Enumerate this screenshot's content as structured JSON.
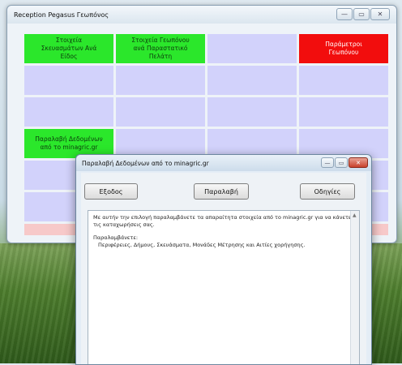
{
  "main_window": {
    "title": "Reception Pegasus Γεωπόνος",
    "controls": {
      "minimize": "—",
      "maximize": "▭",
      "close": "✕"
    },
    "tiles": [
      {
        "line1": "Στοιχεία",
        "line2": "Σκευασμάτων Ανά",
        "line3": "Είδος",
        "color": "green"
      },
      {
        "line1": "Στοιχεία Γεωπόνου",
        "line2": "ανά Παραστατικό",
        "line3": "Πελάτη",
        "color": "green"
      },
      {
        "line1": "",
        "line2": "",
        "line3": "",
        "color": "lavender"
      },
      {
        "line1": "Παράμετροι",
        "line2": "Γεωπόνου",
        "line3": "",
        "color": "red"
      },
      {
        "line1": "Παραλαβή Δεδομένων",
        "line2": "από το minagric.gr",
        "line3": "",
        "color": "green"
      }
    ]
  },
  "dialog": {
    "title": "Παραλαβή Δεδομένων από το minagric.gr",
    "controls": {
      "minimize": "—",
      "maximize": "▭",
      "close": "✕"
    },
    "buttons": {
      "exit": "Εξοδος",
      "receive": "Παραλαβή",
      "guide": "Οδηγίες"
    },
    "text": {
      "line1": "Με αυτήν την επιλογή παραλαμβάνετε τα απαραίτητα στοιχεία από το minagric.gr για να κάνετε",
      "line2": "τις καταχωρήσεις σας.",
      "heading": "Παραλαμβάνετε:",
      "items": "Περιφέρειες, Δήμους, Σκευάσματα, Μονάδες Μέτρησης και Αιτίες χορήγησης."
    }
  }
}
